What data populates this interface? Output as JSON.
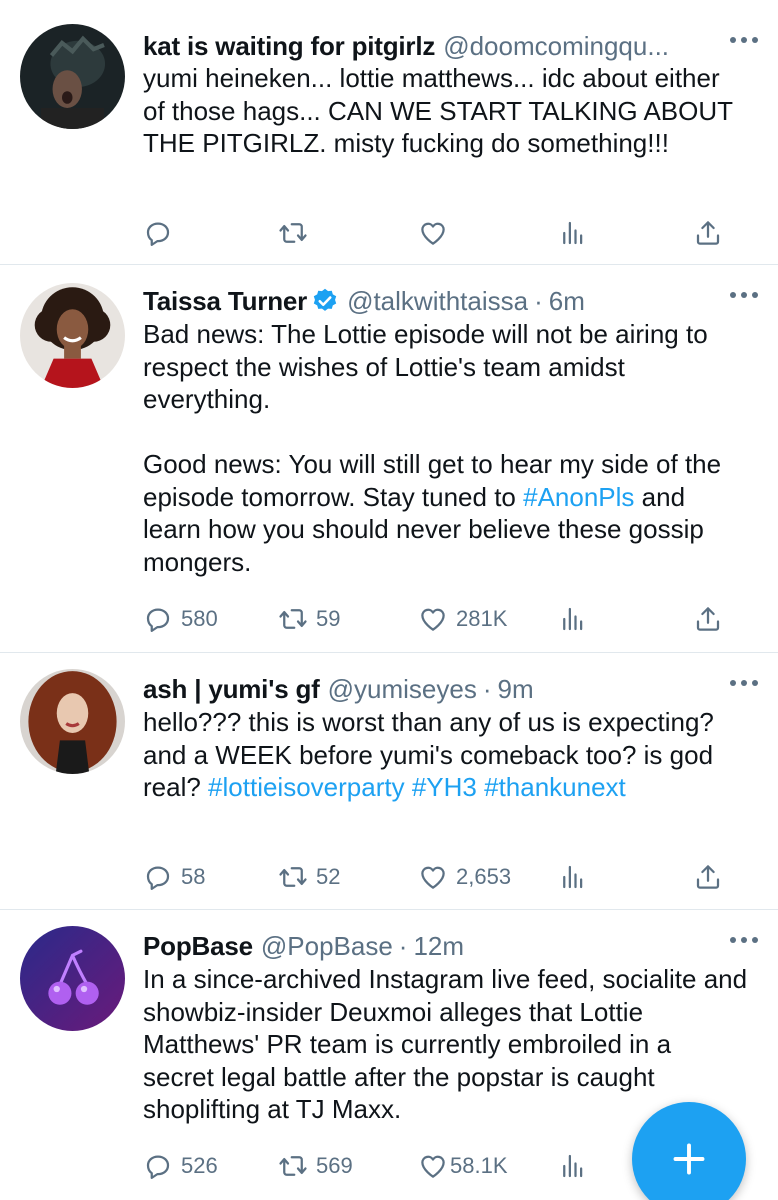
{
  "tweets": [
    {
      "name": "kat is waiting for pitgirlz",
      "handle": "@doomcomingqu...",
      "time": "",
      "verified": false,
      "body": [
        "yumi heineken... lottie matthews... idc about either of those hags... CAN WE START TALKING ABOUT THE PITGIRLZ. misty fucking do something!!!"
      ],
      "replies": "",
      "retweets": "",
      "likes": ""
    },
    {
      "name": "Taissa Turner",
      "handle": "@talkwithtaissa",
      "time": "6m",
      "verified": true,
      "body": [
        "Bad news: The Lottie episode will not be airing to respect the wishes of Lottie's team amidst everything.",
        "Good news: You will still get to hear my side of the episode tomorrow. Stay tuned to ",
        "#AnonPls",
        " and learn how you should never believe these gossip mongers."
      ],
      "replies": "580",
      "retweets": "59",
      "likes": "281K"
    },
    {
      "name": "ash | yumi's gf",
      "handle": "@yumiseyes",
      "time": "9m",
      "verified": false,
      "body": [
        "hello??? this is worst than any of us is expecting? and a WEEK before yumi's comeback too? is god real? ",
        "#lottieisoverparty",
        "#YH3",
        "#thankunext"
      ],
      "replies": "58",
      "retweets": "52",
      "likes": "2,653"
    },
    {
      "name": "PopBase",
      "handle": "@PopBase",
      "time": "12m",
      "verified": false,
      "body": [
        "In a since-archived Instagram live feed, socialite and showbiz-insider Deuxmoi alleges that Lottie Matthews' PR team is currently embroiled in a secret legal battle after the popstar is caught shoplifting at TJ Maxx."
      ],
      "replies": "526",
      "retweets": "569",
      "likes": "58.1K"
    }
  ],
  "dot_separator": "·",
  "icons": {
    "reply": "reply-icon",
    "retweet": "retweet-icon",
    "like": "heart-icon",
    "stats": "stats-icon",
    "share": "share-icon",
    "more": "more-icon",
    "compose": "compose-plus-icon",
    "verified": "verified-badge-icon"
  },
  "colors": {
    "accent": "#1da1f2",
    "muted": "#5b7083",
    "text": "#0f1419",
    "divider": "#e1e8ed"
  }
}
